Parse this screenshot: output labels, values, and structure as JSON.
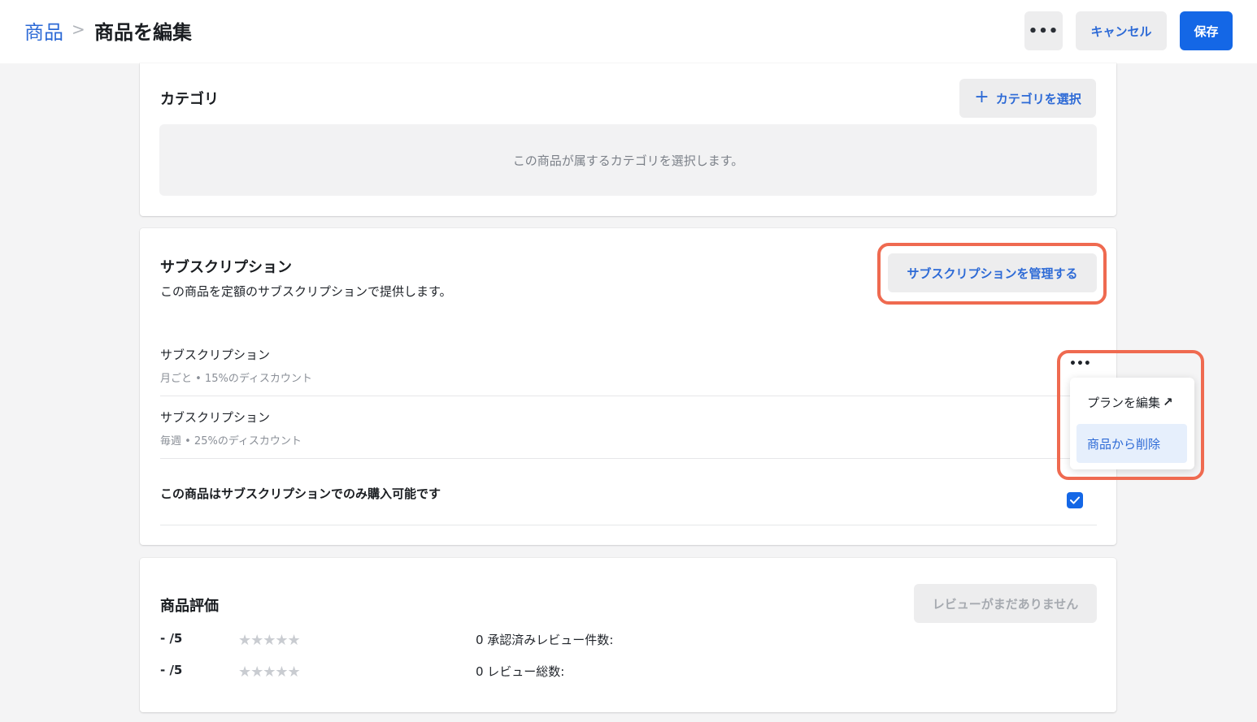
{
  "header": {
    "breadcrumb_parent": "商品",
    "breadcrumb_separator": ">",
    "title": "商品を編集",
    "more_label": "•••",
    "cancel_label": "キャンセル",
    "save_label": "保存"
  },
  "category": {
    "title": "カテゴリ",
    "select_button": "カテゴリを選択",
    "select_button_icon": "plus-icon",
    "empty_text": "この商品が属するカテゴリを選択します。"
  },
  "subscription": {
    "title": "サブスクリプション",
    "description": "この商品を定額のサブスクリプションで提供します。",
    "manage_button": "サブスクリプションを管理する",
    "plans": [
      {
        "name": "サブスクリプション",
        "meta": "月ごと • 15%のディスカウント"
      },
      {
        "name": "サブスクリプション",
        "meta": "毎週 • 25%のディスカウント"
      }
    ],
    "row_more_label": "•••",
    "menu": {
      "edit_label": "プランを編集",
      "edit_icon": "external-arrow-icon",
      "remove_label": "商品から削除"
    },
    "only_subscription_label": "この商品はサブスクリプションでのみ購入可能です",
    "only_subscription_checked": true
  },
  "reviews": {
    "title": "商品評価",
    "no_reviews_button": "レビューがまだありません",
    "rows": [
      {
        "score": "- /5",
        "stars": "★★★★★",
        "text": "0 承認済みレビュー件数:"
      },
      {
        "score": "- /5",
        "stars": "★★★★★",
        "text": "0 レビュー総数:"
      }
    ]
  },
  "colors": {
    "accent": "#1467e6",
    "link": "#2d6ad6",
    "highlight": "#ef6a50",
    "background": "#f4f4f5"
  }
}
